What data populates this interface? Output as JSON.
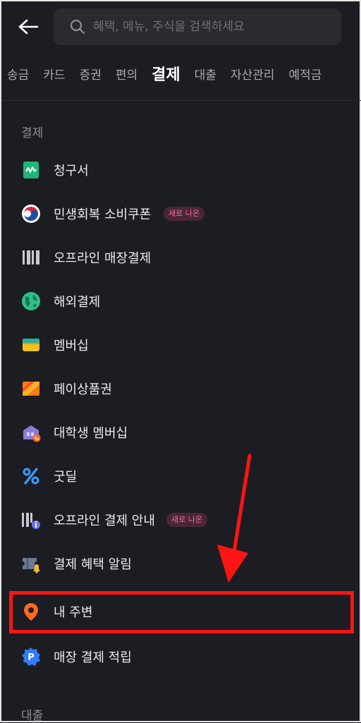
{
  "header": {
    "back_icon": "arrow-left-icon",
    "search_icon": "search-icon",
    "search_placeholder": "혜택, 메뉴, 주식을 검색하세요",
    "search_value": ""
  },
  "tabs": [
    {
      "label": "송금"
    },
    {
      "label": "카드"
    },
    {
      "label": "증권"
    },
    {
      "label": "편의"
    },
    {
      "label": "결제",
      "active": true
    },
    {
      "label": "대출"
    },
    {
      "label": "자산관리"
    },
    {
      "label": "예적금"
    }
  ],
  "section_payment": {
    "title": "결제",
    "items": [
      {
        "label": "청구서",
        "icon": "bill-icon"
      },
      {
        "label": "민생회복 소비쿠폰",
        "icon": "korea-emblem-icon",
        "badge": "새로 나온"
      },
      {
        "label": "오프라인 매장결제",
        "icon": "barcode-icon"
      },
      {
        "label": "해외결제",
        "icon": "globe-icon"
      },
      {
        "label": "멤버십",
        "icon": "wallet-icon"
      },
      {
        "label": "페이상품권",
        "icon": "gift-card-icon"
      },
      {
        "label": "대학생 멤버십",
        "icon": "university-icon"
      },
      {
        "label": "굿딜",
        "icon": "percent-icon"
      },
      {
        "label": "오프라인 결제 안내",
        "icon": "barcode-info-icon",
        "badge": "새로 나온"
      },
      {
        "label": "결제 혜택 알림",
        "icon": "ticket-bell-icon"
      },
      {
        "label": "내 주변",
        "icon": "location-pin-icon"
      },
      {
        "label": "매장 결제 적립",
        "icon": "point-badge-icon"
      }
    ]
  },
  "section_loan": {
    "title": "대출"
  },
  "colors": {
    "background": "#1c1d22",
    "highlight": "#ff1414",
    "badge_text": "#f06ca0"
  }
}
